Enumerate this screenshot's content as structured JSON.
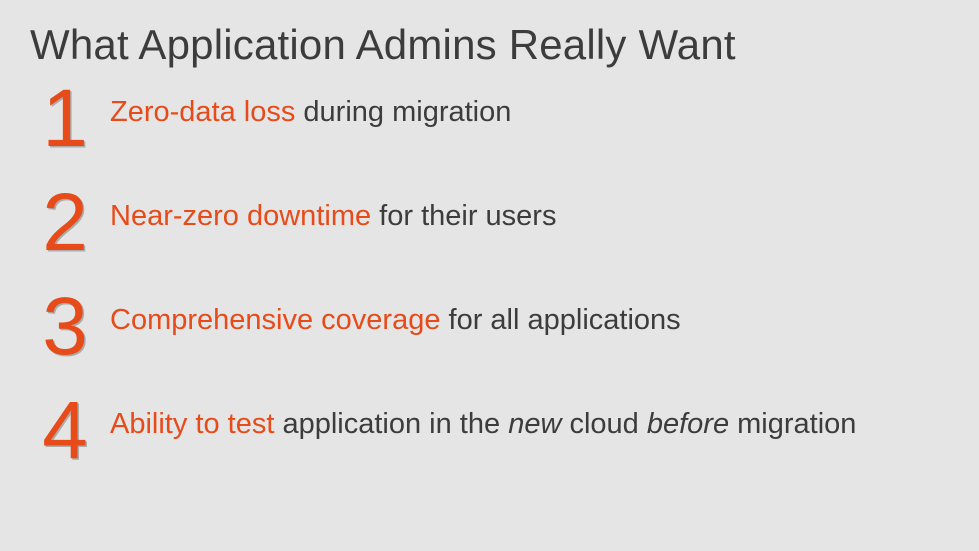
{
  "title": "What Application Admins Really Want",
  "items": [
    {
      "num": "1",
      "highlight": "Zero-data loss",
      "rest_a": " during migration",
      "em1": "",
      "mid": "",
      "em2": "",
      "tail": ""
    },
    {
      "num": "2",
      "highlight": "Near-zero downtime",
      "rest_a": " for their users",
      "em1": "",
      "mid": "",
      "em2": "",
      "tail": ""
    },
    {
      "num": "3",
      "highlight": "Comprehensive coverage",
      "rest_a": " for all applications",
      "em1": "",
      "mid": "",
      "em2": "",
      "tail": ""
    },
    {
      "num": "4",
      "highlight": "Ability to test",
      "rest_a": " application in the ",
      "em1": "new",
      "mid": " cloud ",
      "em2": "before",
      "tail": " migration"
    }
  ],
  "colors": {
    "accent": "#e64b19",
    "text": "#3c3c3c",
    "bg": "#e5e5e5"
  }
}
